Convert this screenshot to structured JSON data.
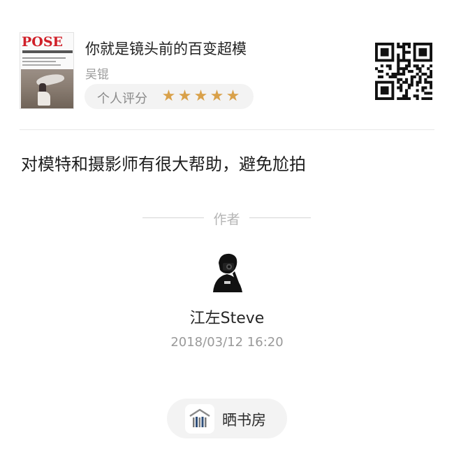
{
  "book": {
    "cover_title": "POSE",
    "title": "你就是镜头前的百变超模",
    "author": "吴锟",
    "rating_label": "个人评分",
    "rating_stars": 5,
    "rating_max": 5,
    "star_color": "#d9a14a"
  },
  "qr_icon": "qr-code-icon",
  "review": {
    "text": "对模特和摄影师有很大帮助，避免尬拍"
  },
  "author_section": {
    "label": "作者",
    "username": "江左Steve",
    "timestamp": "2018/03/12  16:20"
  },
  "action": {
    "label": "晒书房",
    "icon": "bookshelf-icon"
  }
}
